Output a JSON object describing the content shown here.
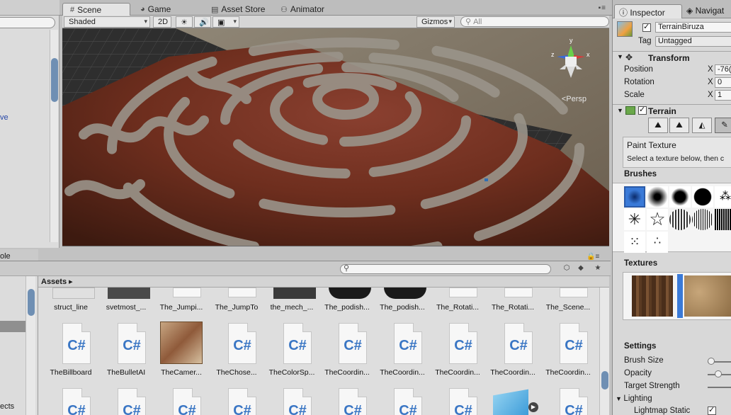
{
  "tabs": {
    "scene": "Scene",
    "game": "Game",
    "asset_store": "Asset Store",
    "animator": "Animator"
  },
  "scene_toolbar": {
    "shading": "Shaded",
    "mode_2d": "2D",
    "gizmos": "Gizmos",
    "search_placeholder": "All"
  },
  "scene": {
    "view_label": "Persp",
    "axis_x": "x",
    "axis_y": "y",
    "axis_z": "z"
  },
  "left": {
    "partial_link": "ve",
    "bottom_header": "ole",
    "bottom_text": "ects"
  },
  "project": {
    "breadcrumb": "Assets",
    "row1": [
      "struct_line",
      "svetmost_...",
      "The_Jumpi...",
      "The_JumpTo",
      "the_mech_...",
      "The_podish...",
      "The_podish...",
      "The_Rotati...",
      "The_Rotati...",
      "The_Scene..."
    ],
    "row2": [
      "TheBillboard",
      "TheBulletAI",
      "TheCamer...",
      "TheChose...",
      "TheColorSp...",
      "TheCoordin...",
      "TheCoordin...",
      "TheCoordin...",
      "TheCoordin...",
      "TheCoordin..."
    ],
    "cs_label": "C#"
  },
  "inspector": {
    "tab": "Inspector",
    "tab2": "Navigat",
    "object_name": "TerrainBiruza",
    "tag_label": "Tag",
    "tag_value": "Untagged",
    "transform": {
      "title": "Transform",
      "position": "Position",
      "rotation": "Rotation",
      "scale": "Scale",
      "x": "X",
      "pos_x": "-76(",
      "rot_x": "0",
      "scale_x": "1"
    },
    "terrain": {
      "title": "Terrain",
      "mode_title": "Paint Texture",
      "mode_help": "Select a texture below, then c",
      "brushes": "Brushes",
      "textures": "Textures",
      "settings": "Settings",
      "brush_size": "Brush Size",
      "opacity": "Opacity",
      "target_strength": "Target Strength",
      "lighting": "Lighting",
      "lightmap_static": "Lightmap Static"
    }
  }
}
